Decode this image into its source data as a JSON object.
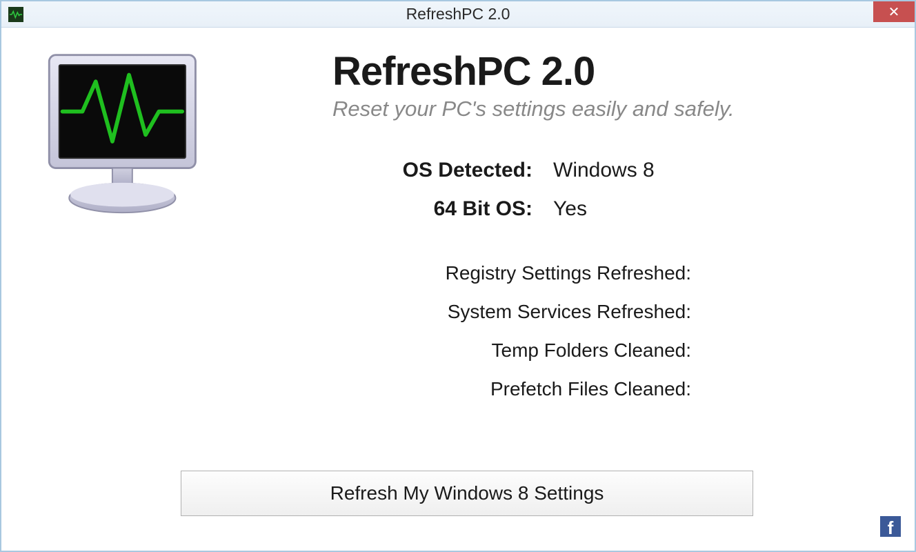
{
  "window": {
    "title": "RefreshPC 2.0"
  },
  "header": {
    "app_name": "RefreshPC 2.0",
    "tagline": "Reset your PC's settings easily and safely."
  },
  "info": {
    "os_label": "OS Detected:",
    "os_value": "Windows 8",
    "arch_label": "64 Bit OS:",
    "arch_value": "Yes"
  },
  "status": {
    "registry": "Registry Settings Refreshed:",
    "services": "System Services Refreshed:",
    "temp": "Temp Folders Cleaned:",
    "prefetch": "Prefetch Files Cleaned:"
  },
  "actions": {
    "refresh_label": "Refresh My Windows 8 Settings"
  },
  "icons": {
    "close": "✕",
    "facebook": "f"
  }
}
